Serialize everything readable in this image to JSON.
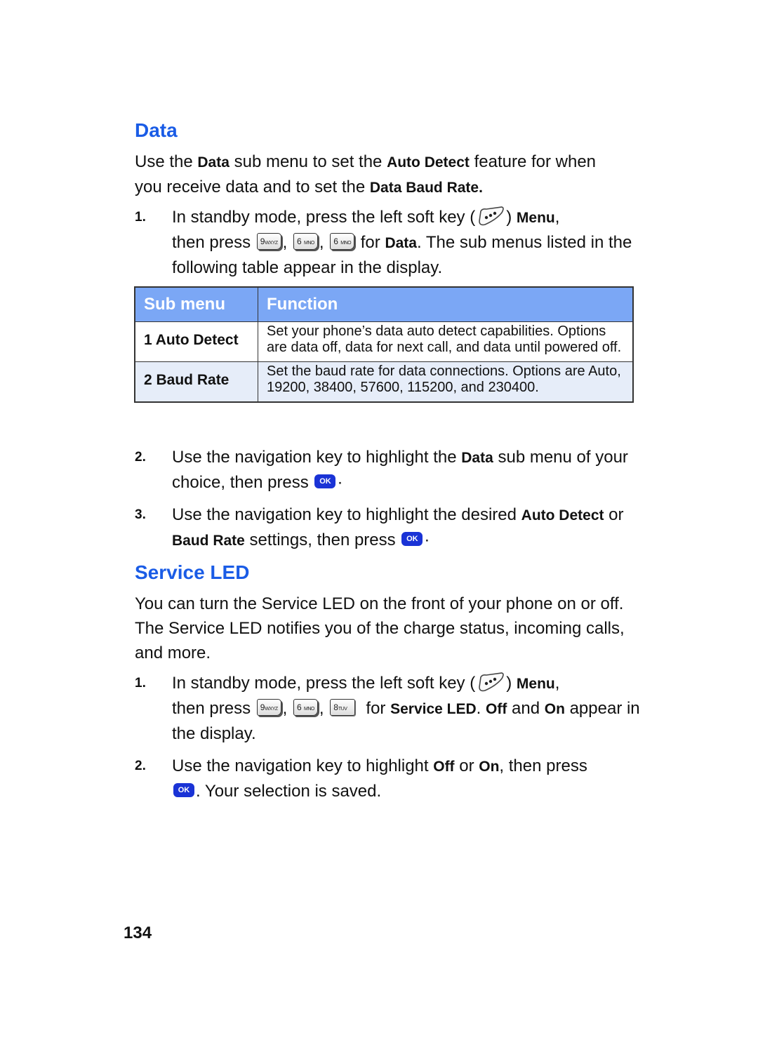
{
  "page_number": "134",
  "colors": {
    "heading": "#1a5ce6",
    "table_header": "#7ba7f5",
    "table_alt_row": "#e6edf9",
    "ok_button": "#1a33d6"
  },
  "data_section": {
    "title": "Data",
    "intro": {
      "t1": "Use the ",
      "b1": "Data",
      "t2": " sub menu to set the ",
      "b2": "Auto Detect",
      "t3": " feature for when you receive data and to set the ",
      "b3": "Data Baud Rate."
    },
    "step1": {
      "num": "1.",
      "t1": "In standby mode, press the left soft key (",
      "t2": ") ",
      "b1": "Menu",
      "t3": ",",
      "t4": "then press ",
      "keys": [
        {
          "main": "9",
          "sub": "WXYZ"
        },
        {
          "main": "6",
          "sub": "MNO"
        },
        {
          "main": "6",
          "sub": "MNO"
        }
      ],
      "t5": " for ",
      "b2": "Data",
      "t6": ". The sub menus listed in the following table appear in the display."
    },
    "table": {
      "headers": [
        "Sub menu",
        "Function"
      ],
      "rows": [
        {
          "name": "1 Auto Detect",
          "function": "Set your phone’s data auto detect capabilities. Options are data off, data for next call, and data until powered off."
        },
        {
          "name": "2 Baud Rate",
          "function": "Set the baud rate for data connections. Options are Auto, 19200, 38400, 57600, 115200, and 230400."
        }
      ]
    },
    "step2": {
      "num": "2.",
      "t1": "Use the navigation key to highlight the ",
      "b1": "Data",
      "t2": " sub menu of your choice, then press ",
      "t3": "·"
    },
    "step3": {
      "num": "3.",
      "t1": "Use the navigation key to highlight the desired ",
      "b1": "Auto Detect",
      "t2": " or ",
      "b2": "Baud Rate",
      "t3": " settings, then press ",
      "t4": "·"
    }
  },
  "led_section": {
    "title": "Service LED",
    "intro": "You can turn the Service LED on the front of your phone on or off. The Service LED notifies you of the charge status, incoming calls, and more.",
    "step1": {
      "num": "1.",
      "t1": "In standby mode, press the left soft key (",
      "t2": ") ",
      "b1": "Menu",
      "t3": ",",
      "t4": "then press ",
      "keys": [
        {
          "main": "9",
          "sub": "WXYZ"
        },
        {
          "main": "6",
          "sub": "MNO"
        },
        {
          "main": "8",
          "sub": "TUV"
        }
      ],
      "t5": " for ",
      "b2": "Service LED",
      "t6": ". ",
      "b3": "Off",
      "t7": " and ",
      "b4": "On",
      "t8": " appear in the display."
    },
    "step2": {
      "num": "2.",
      "t1": "Use the navigation key to highlight ",
      "b1": "Off",
      "t2": " or ",
      "b2": "On",
      "t3": ", then press",
      "t4": ". Your selection is saved."
    }
  },
  "icons": {
    "soft_key": "left-soft-key-icon",
    "ok": "ok-key-icon",
    "ok_label": "OK"
  }
}
